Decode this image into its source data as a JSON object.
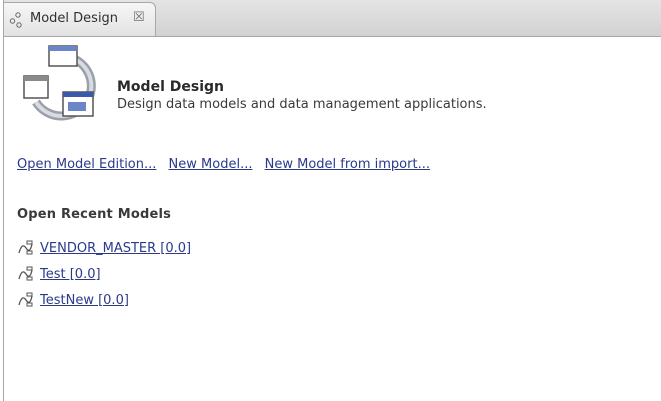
{
  "tab": {
    "title": "Model Design",
    "close_glyph": "☒"
  },
  "header": {
    "title": "Model Design",
    "description": "Design data models and data management applications."
  },
  "actions": {
    "open_model_edition": "Open Model Edition...",
    "new_model": "New Model...",
    "new_model_from_import": "New Model from import..."
  },
  "recent": {
    "heading": "Open Recent Models",
    "items": [
      {
        "label": "VENDOR_MASTER [0.0]"
      },
      {
        "label": "Test [0.0]"
      },
      {
        "label": "TestNew [0.0]"
      }
    ]
  },
  "icons": {
    "tab": "model-design-icon",
    "header": "model-design-large-icon",
    "recent": "data-model-icon"
  },
  "colors": {
    "link": "#2a3a8a",
    "tabbar": "#d2d2d2",
    "accent_blue": "#6a86c8"
  }
}
